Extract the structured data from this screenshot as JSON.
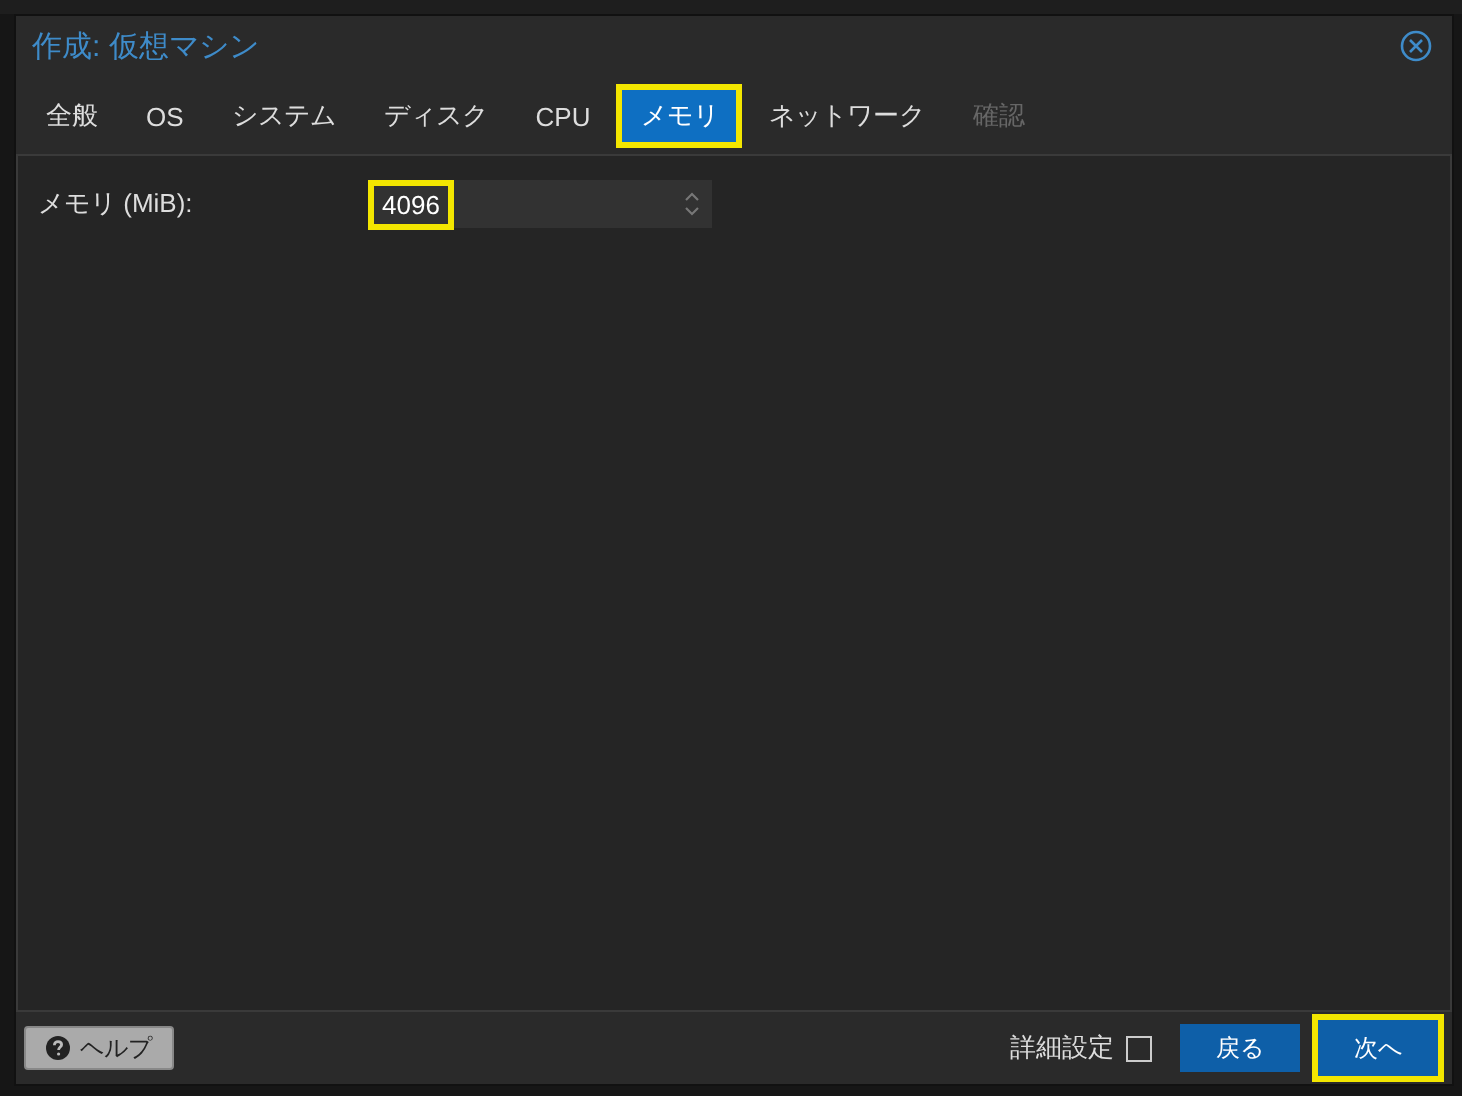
{
  "window": {
    "title": "作成: 仮想マシン"
  },
  "tabs": [
    {
      "label": "全般",
      "selected": false,
      "disabled": false,
      "highlighted": false
    },
    {
      "label": "OS",
      "selected": false,
      "disabled": false,
      "highlighted": false
    },
    {
      "label": "システム",
      "selected": false,
      "disabled": false,
      "highlighted": false
    },
    {
      "label": "ディスク",
      "selected": false,
      "disabled": false,
      "highlighted": false
    },
    {
      "label": "CPU",
      "selected": false,
      "disabled": false,
      "highlighted": false
    },
    {
      "label": "メモリ",
      "selected": true,
      "disabled": false,
      "highlighted": true
    },
    {
      "label": "ネットワーク",
      "selected": false,
      "disabled": false,
      "highlighted": false
    },
    {
      "label": "確認",
      "selected": false,
      "disabled": true,
      "highlighted": false
    }
  ],
  "form": {
    "label": "メモリ (MiB):",
    "value": "4096",
    "highlighted": true
  },
  "footer": {
    "help": "ヘルプ",
    "advanced": {
      "label": "詳細設定",
      "checked": false
    },
    "buttons": [
      {
        "label": "戻る",
        "highlighted": false
      },
      {
        "label": "次へ",
        "highlighted": true
      }
    ]
  }
}
